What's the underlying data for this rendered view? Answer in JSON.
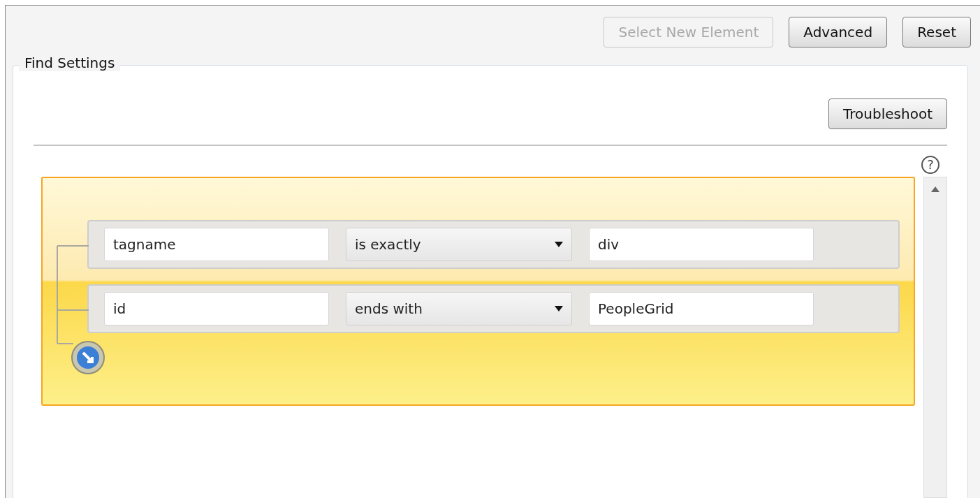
{
  "toolbar": {
    "buttons": [
      {
        "label": "Select New Element",
        "disabled": true
      },
      {
        "label": "Advanced",
        "disabled": false
      },
      {
        "label": "Reset",
        "disabled": false
      }
    ]
  },
  "find_settings": {
    "title": "Find Settings",
    "troubleshoot_button": "Troubleshoot",
    "help_icon": "?",
    "rules": [
      {
        "attribute": "tagname",
        "operator": "is exactly",
        "value": "div"
      },
      {
        "attribute": "id",
        "operator": "ends with",
        "value": "PeopleGrid"
      }
    ]
  }
}
